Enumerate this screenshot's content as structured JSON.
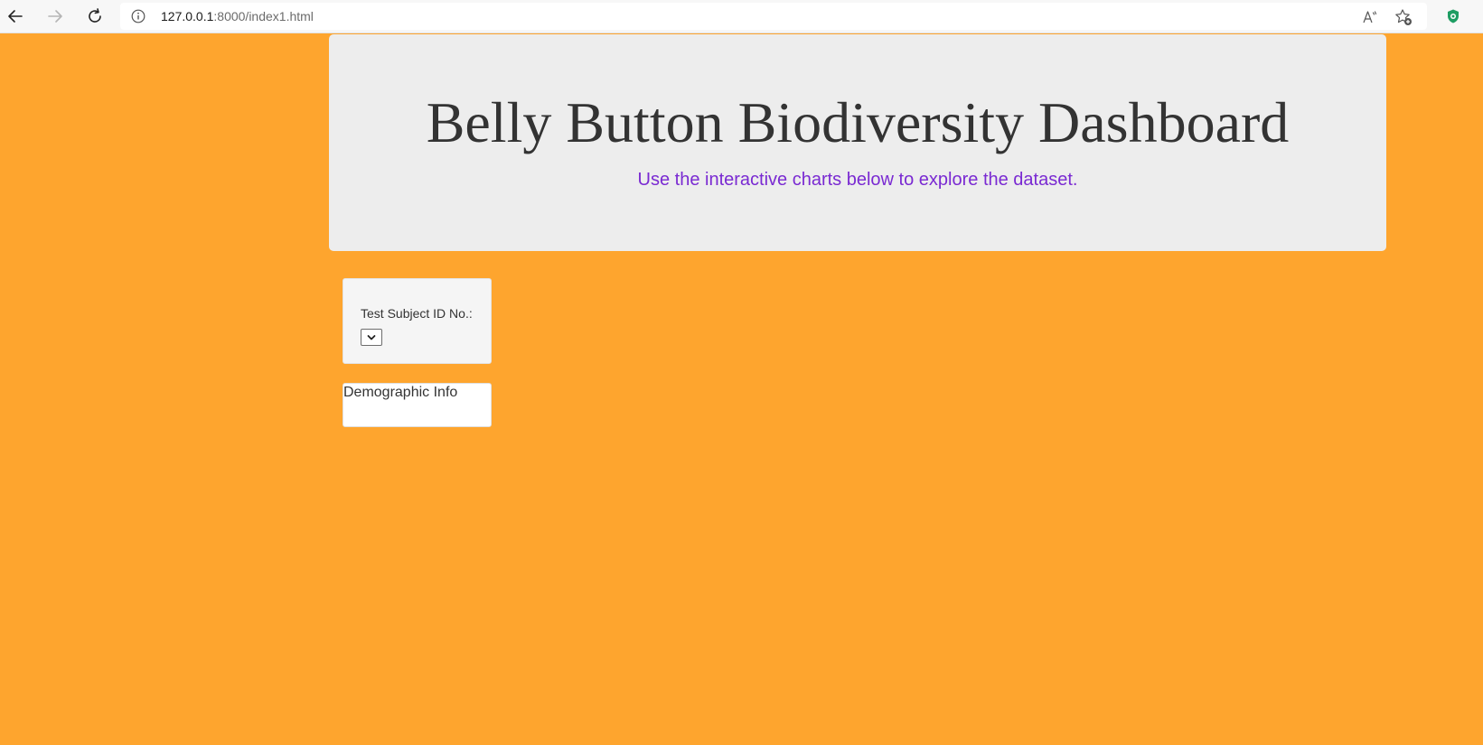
{
  "browser": {
    "url_host": "127.0.0.1",
    "url_rest": ":8000/index1.html",
    "icons": {
      "back": "back-arrow-icon",
      "forward": "forward-arrow-icon",
      "refresh": "refresh-icon",
      "info": "info-icon",
      "read_aloud": "read-aloud-icon",
      "favorites": "add-favorite-icon",
      "extension": "shield-extension-icon"
    }
  },
  "header": {
    "title": "Belly Button Biodiversity Dashboard",
    "subtitle": "Use the interactive charts below to explore the dataset."
  },
  "selector": {
    "label": "Test Subject ID No.:",
    "selected_value": ""
  },
  "demographics": {
    "title": "Demographic Info"
  },
  "colors": {
    "page_background": "#fea52e",
    "jumbotron_background": "#ededed",
    "subtitle_color": "#7a2ad2",
    "title_color": "#333333"
  }
}
